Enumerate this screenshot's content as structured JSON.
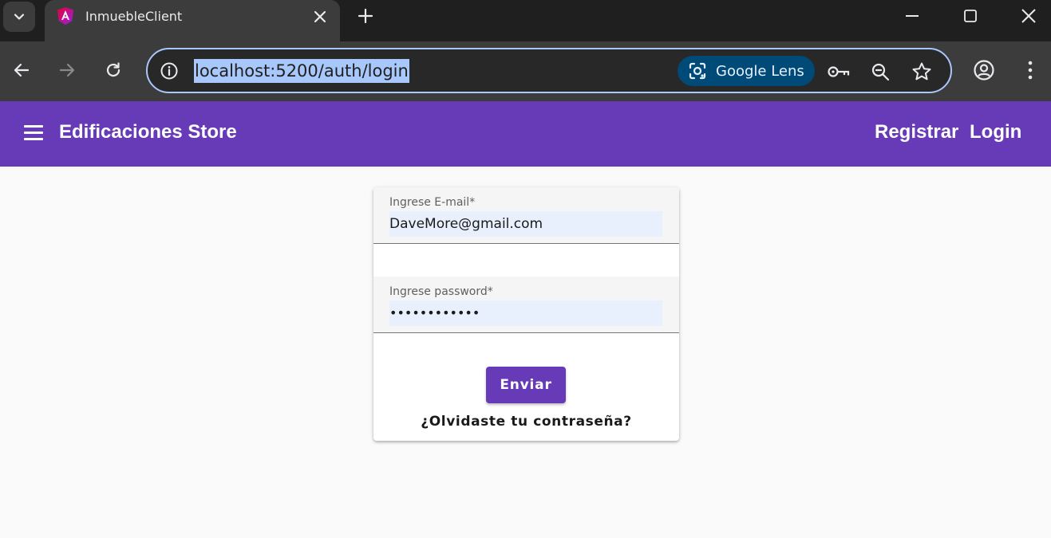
{
  "browser": {
    "tab": {
      "title": "InmuebleClient",
      "favicon": "angular-logo-icon"
    },
    "address_bar": {
      "url": "localhost:5200/auth/login"
    },
    "lens_button_label": "Google Lens",
    "icons": [
      "tab-search-icon",
      "close-icon",
      "plus-icon",
      "minimize-icon",
      "maximize-icon",
      "window-close-icon",
      "back-icon",
      "forward-icon",
      "reload-icon",
      "site-info-icon",
      "lens-icon",
      "key-icon",
      "zoom-icon",
      "star-icon",
      "profile-icon",
      "kebab-menu-icon"
    ]
  },
  "app": {
    "header": {
      "title": "Edificaciones Store",
      "register_link": "Registrar",
      "login_link": "Login"
    },
    "login_form": {
      "email_label": "Ingrese E-mail*",
      "email_value": "DaveMore@gmail.com",
      "password_label": "Ingrese password*",
      "password_value": "••••••••••••",
      "submit_label": "Enviar",
      "forgot_label": "¿Olvidaste tu contraseña?"
    }
  },
  "colors": {
    "primary": "#673ab7",
    "autofill": "#e8f0fe",
    "chrome_dark": "#1f1f1f",
    "chrome_toolbar": "#3c3c3c",
    "omnibox_border": "#a8c7fa",
    "lens_pill": "#004a77"
  }
}
